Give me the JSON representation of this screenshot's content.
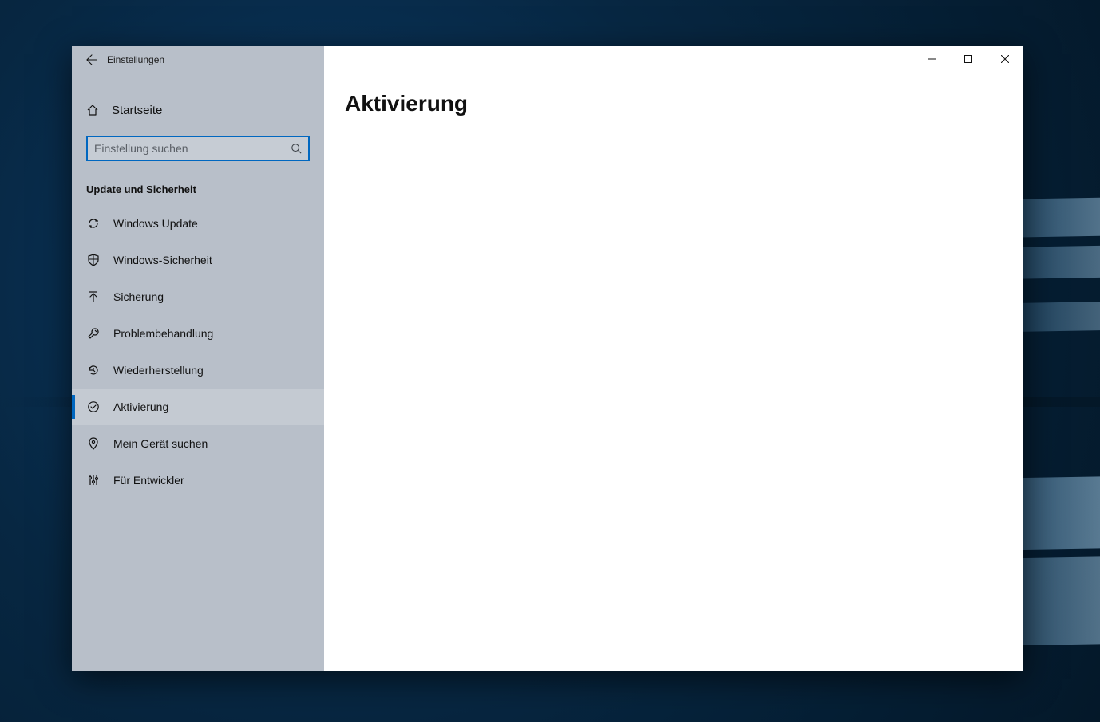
{
  "window": {
    "title": "Einstellungen"
  },
  "sidebar": {
    "home": "Startseite",
    "search_placeholder": "Einstellung suchen",
    "section": "Update und Sicherheit",
    "items": [
      {
        "label": "Windows Update"
      },
      {
        "label": "Windows-Sicherheit"
      },
      {
        "label": "Sicherung"
      },
      {
        "label": "Problembehandlung"
      },
      {
        "label": "Wiederherstellung"
      },
      {
        "label": "Aktivierung"
      },
      {
        "label": "Mein Gerät suchen"
      },
      {
        "label": "Für Entwickler"
      }
    ]
  },
  "content": {
    "heading": "Aktivierung"
  }
}
